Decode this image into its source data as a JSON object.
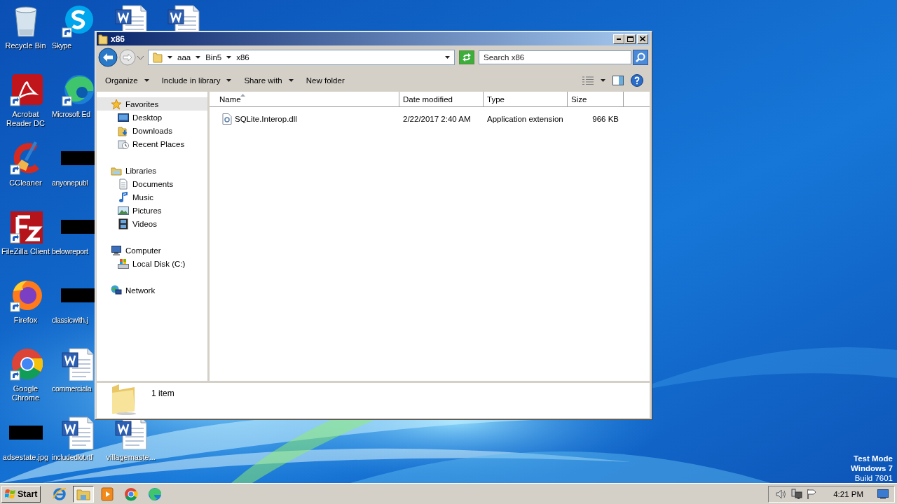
{
  "desktop": {
    "icons": [
      {
        "label": "Recycle Bin",
        "kind": "recycle",
        "shortcut": false
      },
      {
        "label": "Acrobat Reader DC",
        "kind": "acrobat",
        "shortcut": true
      },
      {
        "label": "CCleaner",
        "kind": "ccleaner",
        "shortcut": true
      },
      {
        "label": "FileZilla Client",
        "kind": "filezilla",
        "shortcut": true
      },
      {
        "label": "Firefox",
        "kind": "firefox",
        "shortcut": true
      },
      {
        "label": "Google Chrome",
        "kind": "chrome",
        "shortcut": true
      },
      {
        "label": "adsestate.jpg",
        "kind": "redacted",
        "shortcut": false
      },
      {
        "label": "Skype",
        "kind": "skype",
        "shortcut": true
      },
      {
        "label": "Microsoft Ed",
        "kind": "edge",
        "shortcut": true
      },
      {
        "label": "anyonepubl",
        "kind": "redacted",
        "shortcut": false
      },
      {
        "label": "belowreport",
        "kind": "redacted",
        "shortcut": false
      },
      {
        "label": "classicwith.j",
        "kind": "redacted",
        "shortcut": false
      },
      {
        "label": "commerciala",
        "kind": "word",
        "shortcut": false
      },
      {
        "label": "includedlot.rtf",
        "kind": "word",
        "shortcut": false
      },
      {
        "kind": "word",
        "shortcut": false
      },
      {
        "label": "villagemaste...",
        "kind": "word",
        "shortcut": false
      },
      {
        "kind": "word",
        "shortcut": false
      }
    ],
    "system_text": [
      "Test Mode",
      "Windows 7",
      "Build 7601"
    ]
  },
  "window": {
    "title": "x86",
    "breadcrumb": [
      "aaa",
      "Bin5",
      "x86"
    ],
    "search": {
      "placeholder": "Search x86"
    },
    "toolbar": [
      {
        "label": "Organize",
        "has_menu": true
      },
      {
        "label": "Include in library",
        "has_menu": true
      },
      {
        "label": "Share with",
        "has_menu": true
      },
      {
        "label": "New folder",
        "has_menu": false
      }
    ],
    "nav": [
      {
        "label": "Favorites",
        "kind": "star",
        "selected": true,
        "children": [
          {
            "label": "Desktop",
            "kind": "desktop",
            "selected": false
          },
          {
            "label": "Downloads",
            "kind": "downloads",
            "selected": false
          },
          {
            "label": "Recent Places",
            "kind": "recent",
            "selected": false
          }
        ]
      },
      {
        "label": "Libraries",
        "kind": "libraries",
        "selected": false,
        "children": [
          {
            "label": "Documents",
            "kind": "documents",
            "selected": false
          },
          {
            "label": "Music",
            "kind": "music",
            "selected": false
          },
          {
            "label": "Pictures",
            "kind": "pictures",
            "selected": false
          },
          {
            "label": "Videos",
            "kind": "videos",
            "selected": false
          }
        ]
      },
      {
        "label": "Computer",
        "kind": "computer",
        "selected": false,
        "children": [
          {
            "label": "Local Disk (C:)",
            "kind": "disk",
            "selected": false
          }
        ]
      },
      {
        "label": "Network",
        "kind": "network",
        "selected": false
      }
    ],
    "columns": [
      {
        "label": "Name",
        "sorted": true
      },
      {
        "label": "Date modified",
        "sorted": false
      },
      {
        "label": "Type",
        "sorted": false
      },
      {
        "label": "Size",
        "sorted": false
      }
    ],
    "rows": [
      {
        "name": "SQLite.Interop.dll",
        "date_modified": "2/22/2017 2:40 AM",
        "type": "Application extension",
        "size": "966 KB"
      }
    ],
    "status": "1 item"
  },
  "taskbar": {
    "start": "Start",
    "apps": [
      {
        "kind": "ie",
        "active": false
      },
      {
        "kind": "explorer",
        "active": true
      },
      {
        "kind": "media",
        "active": false
      },
      {
        "kind": "chrome",
        "active": false
      },
      {
        "kind": "edge",
        "active": false
      }
    ],
    "clock": "4:21 PM"
  }
}
